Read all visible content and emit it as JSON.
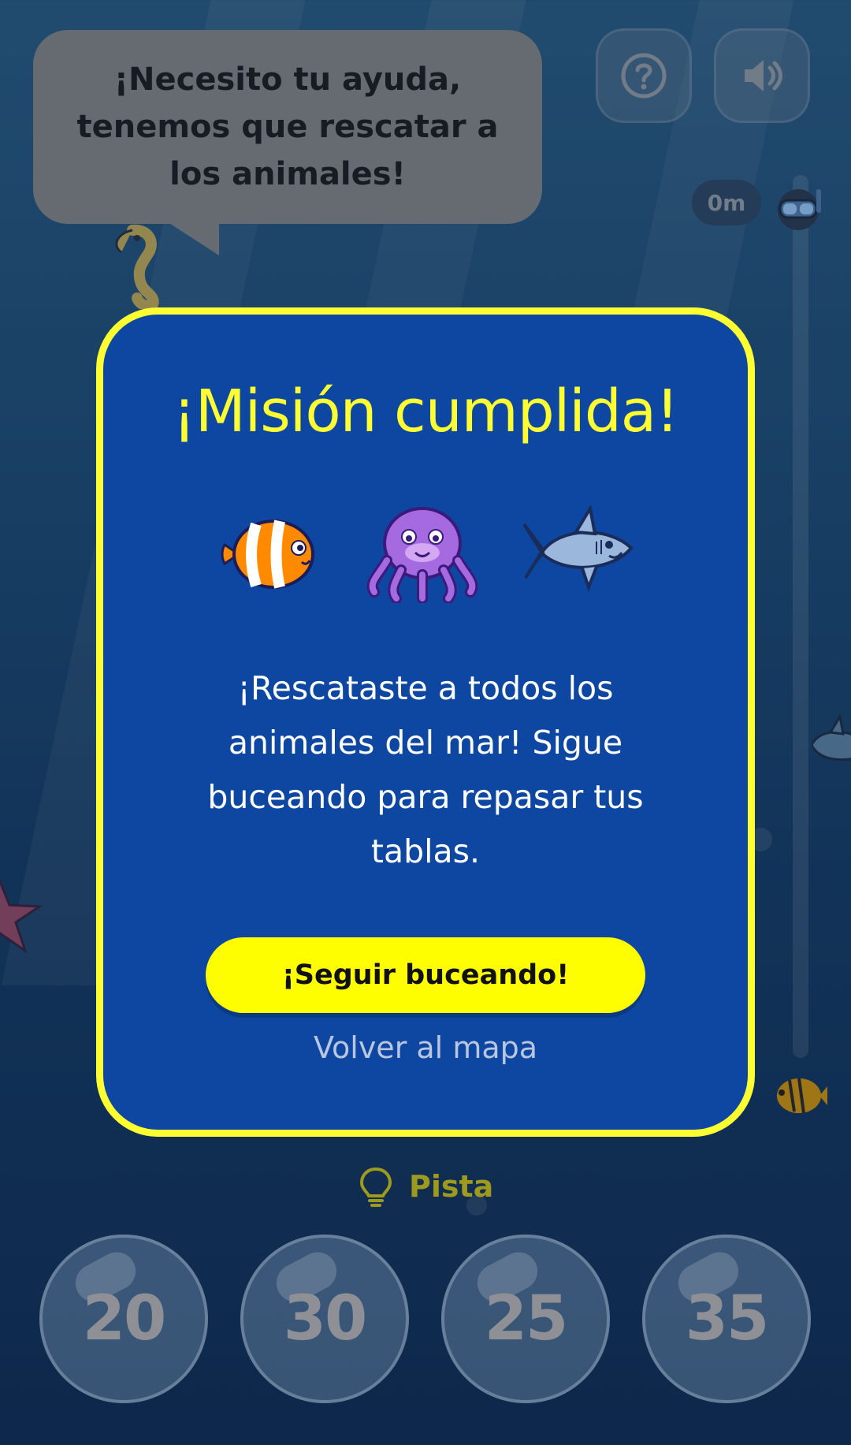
{
  "speech": {
    "text": "¡Necesito tu ayuda, tenemos que rescatar a los animales!"
  },
  "toolbar": {
    "help_icon": "help-icon",
    "sound_icon": "speaker-icon"
  },
  "depth": {
    "label": "0m"
  },
  "modal": {
    "title": "¡Misión cumplida!",
    "animals": [
      "clownfish",
      "octopus",
      "shark"
    ],
    "message": "¡Rescataste a todos los animales del mar! Sigue buceando para repasar tus tablas.",
    "primary_button": "¡Seguir buceando!",
    "secondary_link": "Volver al mapa"
  },
  "hint": {
    "label": "Pista",
    "icon": "lightbulb-icon"
  },
  "answers": [
    "20",
    "30",
    "25",
    "35"
  ],
  "colors": {
    "accent": "#fffe33",
    "modal_bg": "#0e47a1",
    "button": "#fffe00"
  }
}
